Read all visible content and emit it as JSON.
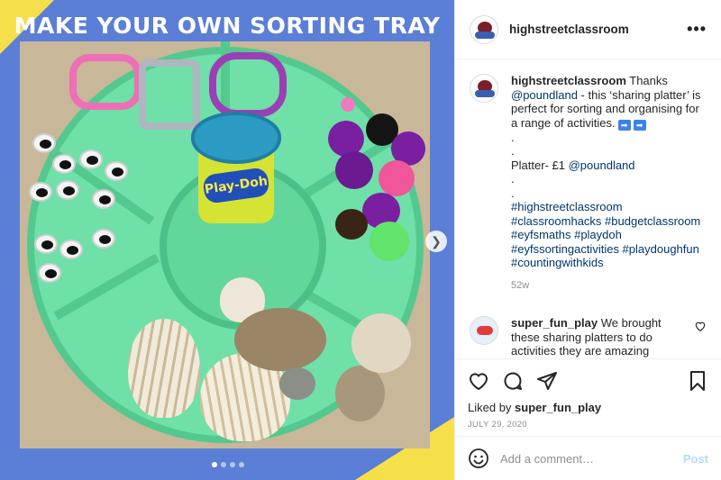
{
  "image": {
    "title": "MAKE YOUR OWN SORTING TRAY",
    "playdoh_label": "Play-Doh",
    "carousel_dots": 4,
    "carousel_active": 1
  },
  "header": {
    "username": "highstreetclassroom",
    "more": "•••"
  },
  "caption": {
    "username": "highstreetclassroom",
    "line1_text": " Thanks ",
    "line1_mention": "@poundland",
    "line1_rest": " - this ‘sharing platter’ is perfect for sorting and organising for a range of activities.",
    "dot1": ".",
    "dot2": ".",
    "platter_text": "Platter- £1 ",
    "platter_mention": "@poundland",
    "dot3": ".",
    "dot4": ".",
    "hashtags": [
      "#highstreetclassroom",
      "#classroomhacks #budgetclassroom",
      "#eyfsmaths #playdoh",
      "#eyfssortingactivities #playdoughfun",
      "#countingwithkids"
    ],
    "time_ago": "52w"
  },
  "comment": {
    "username": "super_fun_play",
    "text": " We brought these sharing platters to do activities they are amazing"
  },
  "actions": {
    "liked_by_prefix": "Liked by ",
    "liked_by_user": "super_fun_play",
    "date": "JULY 29, 2020"
  },
  "add_comment": {
    "placeholder": "Add a comment…",
    "post_label": "Post"
  },
  "colors": {
    "accent_blue": "#5b7fd6",
    "accent_yellow": "#f6e04a",
    "tray_green": "#6fe0a8",
    "link": "#00376b",
    "post_disabled": "#b3dbff"
  }
}
